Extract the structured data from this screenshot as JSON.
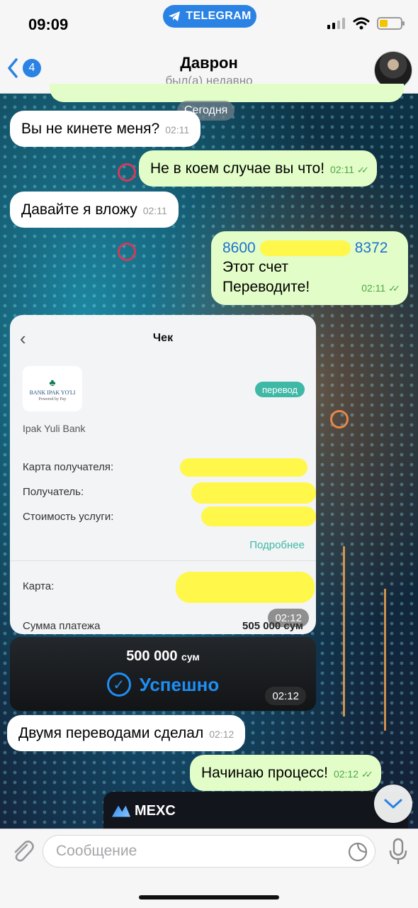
{
  "status_bar": {
    "time": "09:09",
    "return_app_label": "TELEGRAM"
  },
  "header": {
    "back_badge": "4",
    "name": "Даврон",
    "status": "был(а) недавно"
  },
  "date_separator": "Сегодня",
  "messages": [
    {
      "dir": "in",
      "text": "Вы не кинете меня?",
      "time": "02:11"
    },
    {
      "dir": "out",
      "text": "Не в коем случае вы что!",
      "time": "02:11",
      "read": true
    },
    {
      "dir": "in",
      "text": "Давайте я вложу",
      "time": "02:11"
    },
    {
      "dir": "out",
      "card_start": "8600",
      "card_end": "8372",
      "line2": "Этот счет",
      "line3": "Переводите!",
      "time": "02:11",
      "read": true
    },
    {
      "dir": "in",
      "text": "Двумя переводами сделал",
      "time": "02:12"
    },
    {
      "dir": "out",
      "text": "Начинаю процесс!",
      "time": "02:12",
      "read": true
    }
  ],
  "receipt": {
    "title": "Чек",
    "logo_text": "BANK IPAK YO'LI",
    "logo_sub": "Powered by Pay",
    "type_badge": "перевод",
    "bank_name": "Ipak Yuli Bank",
    "label_card_recipient": "Карта получателя:",
    "label_recipient": "Получатель:",
    "label_fee": "Стоимость услуги:",
    "details_link": "Подробнее",
    "label_card": "Карта:",
    "label_total": "Сумма платежа",
    "total_value": "505 000 сум",
    "time": "02:12"
  },
  "success": {
    "amount": "500 000",
    "currency": "сум",
    "status": "Успешно",
    "time": "02:12"
  },
  "mexc": {
    "label": "MEXC"
  },
  "input": {
    "placeholder": "Сообщение"
  },
  "colors": {
    "accent": "#2a82e4",
    "outgoing_bubble": "#e2fdc7",
    "incoming_bubble": "#ffffff",
    "redaction": "#fff74a",
    "success_blue": "#1f8ef3"
  }
}
